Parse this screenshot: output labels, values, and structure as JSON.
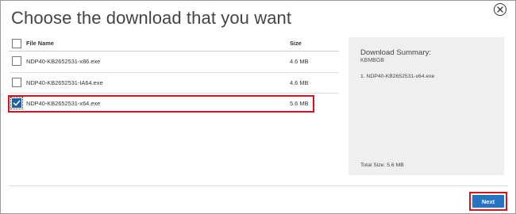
{
  "dialog": {
    "title": "Choose the download that you want"
  },
  "table": {
    "header": {
      "file_name": "File Name",
      "size": "Size"
    },
    "rows": [
      {
        "file_name": "NDP40-KB2652531-x86.exe",
        "size": "4.6 MB",
        "checked": false
      },
      {
        "file_name": "NDP40-KB2652531-IA64.exe",
        "size": "4.6 MB",
        "checked": false
      },
      {
        "file_name": "NDP40-KB2652531-x64.exe",
        "size": "5.6 MB",
        "checked": true
      }
    ]
  },
  "summary": {
    "title": "Download Summary:",
    "size_bytes": "KBMBGB",
    "items": [
      "1. NDP40-KB2652531-x64.exe"
    ],
    "total": "Total Size: 5.6 MB"
  },
  "footer": {
    "next_label": "Next"
  },
  "icons": {
    "close": "close-circle-icon",
    "checkmark": "checkmark-icon"
  },
  "colors": {
    "accent_blue": "#2772c1",
    "checkbox_blue": "#1b5fa8",
    "highlight_red": "#d9131a",
    "panel_bg": "#efefef"
  }
}
